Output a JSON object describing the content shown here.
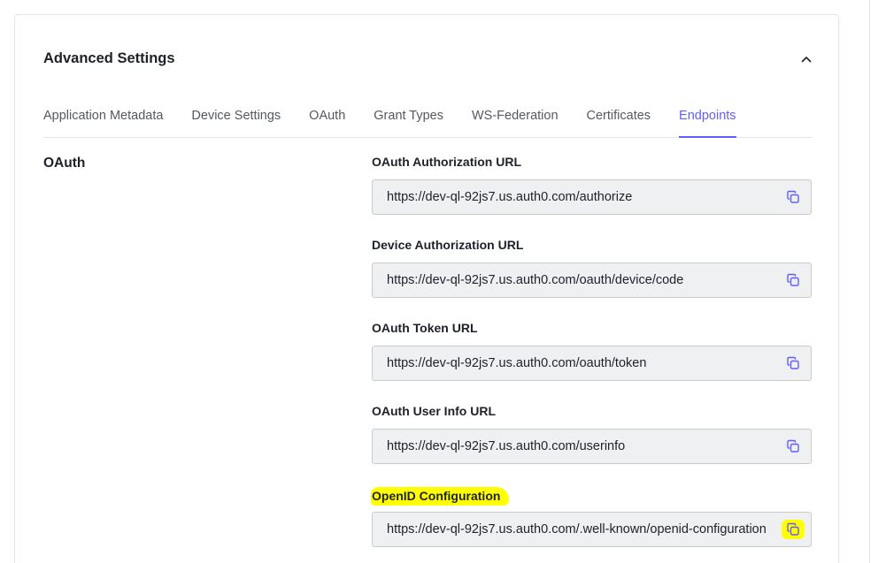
{
  "card": {
    "title": "Advanced Settings"
  },
  "tabs": [
    {
      "label": "Application Metadata"
    },
    {
      "label": "Device Settings"
    },
    {
      "label": "OAuth"
    },
    {
      "label": "Grant Types"
    },
    {
      "label": "WS-Federation"
    },
    {
      "label": "Certificates"
    },
    {
      "label": "Endpoints",
      "active": true
    }
  ],
  "section": {
    "label": "OAuth"
  },
  "fields": [
    {
      "label": "OAuth Authorization URL",
      "value": "https://dev-ql-92js7.us.auth0.com/authorize"
    },
    {
      "label": "Device Authorization URL",
      "value": "https://dev-ql-92js7.us.auth0.com/oauth/device/code"
    },
    {
      "label": "OAuth Token URL",
      "value": "https://dev-ql-92js7.us.auth0.com/oauth/token"
    },
    {
      "label": "OAuth User Info URL",
      "value": "https://dev-ql-92js7.us.auth0.com/userinfo"
    },
    {
      "label": "OpenID Configuration",
      "value": "https://dev-ql-92js7.us.auth0.com/.well-known/openid-configuration",
      "highlighted": true
    }
  ],
  "colors": {
    "accent": "#635dff",
    "highlight": "#ffff00",
    "field_bg": "#eff0f2",
    "border": "#e3e4e8"
  },
  "icons": {
    "collapse": "chevron-up-icon",
    "copy": "copy-icon"
  }
}
